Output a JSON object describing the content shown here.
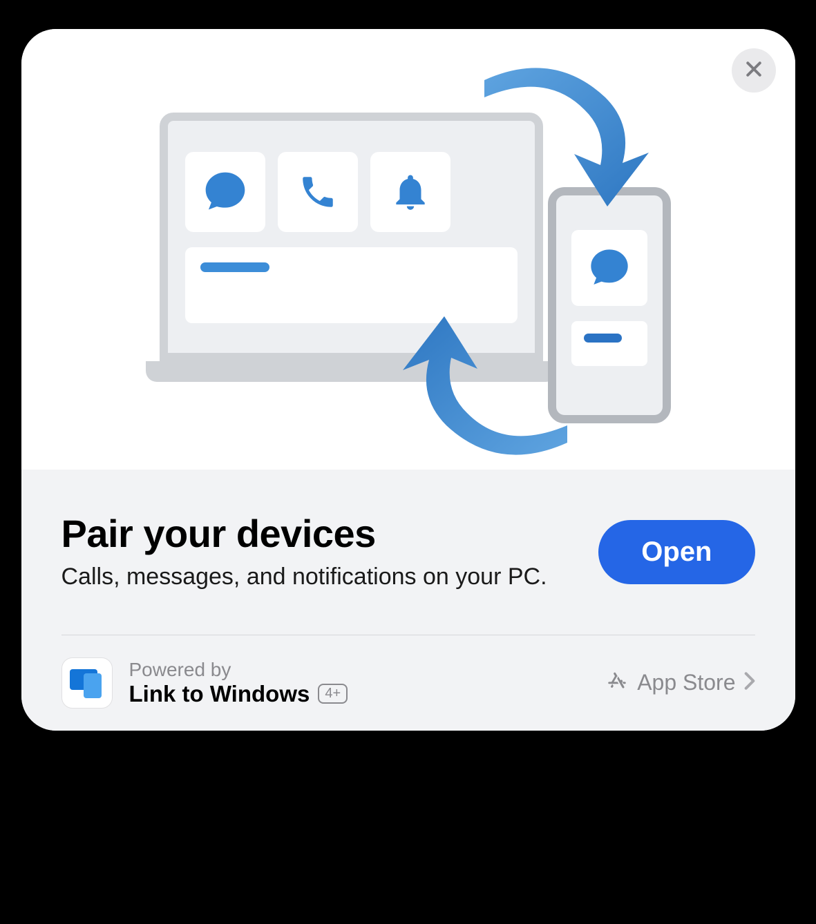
{
  "card": {
    "close_label": "Close",
    "title": "Pair your devices",
    "subtitle": "Calls, messages, and notifications on your PC.",
    "button_label": "Open"
  },
  "footer": {
    "powered_by": "Powered by",
    "app_name": "Link to Windows",
    "age_rating": "4+",
    "store_label": "App Store"
  },
  "illustration": {
    "icons": [
      "chat-bubble",
      "phone-handset",
      "notification-bell"
    ],
    "phone_icon": "chat-bubble"
  }
}
